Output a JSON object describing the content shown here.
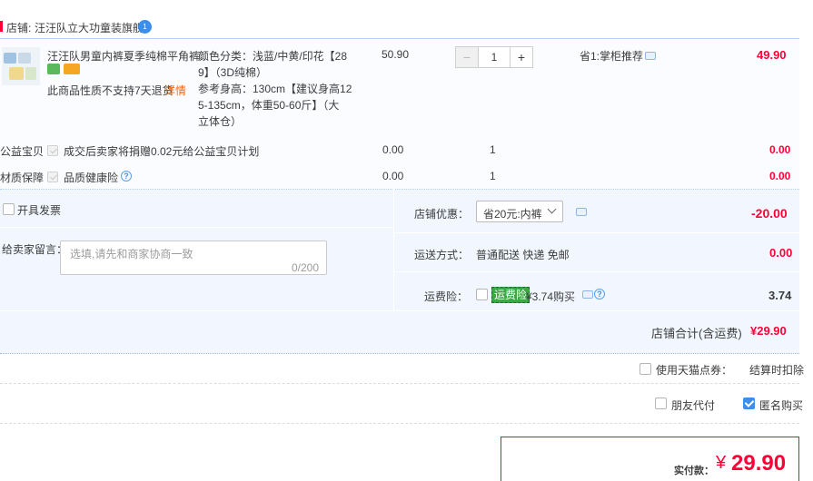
{
  "shop": {
    "label": "店铺:",
    "name": "汪汪队立大功童装旗舰",
    "badge": "1"
  },
  "item": {
    "title": "汪汪队男童内裤夏季纯棉平角裤...",
    "notice": "此商品性质不支持7天退货",
    "detail_link": "详情",
    "sku_lines": [
      "颜色分类：浅蓝/中黄/印花【28",
      "9】（3D纯棉）",
      "参考身高：130cm【建议身高12",
      "5-135cm，体重50-60斤】（大",
      "立体仓）"
    ],
    "price": "50.90",
    "quantity": "1",
    "minus": "−",
    "plus": "+",
    "promo": "省1:掌柜推荐",
    "subtotal": "49.90"
  },
  "services": [
    {
      "category": "公益宝贝",
      "desc": "成交后卖家将捐赠0.02元给公益宝贝计划",
      "price": "0.00",
      "qty": "1",
      "total": "0.00"
    },
    {
      "category": "材质保障",
      "desc": "品质健康险",
      "price": "0.00",
      "qty": "1",
      "total": "0.00"
    }
  ],
  "invoice": {
    "label": "开具发票"
  },
  "message": {
    "label": "给卖家留言：",
    "placeholder": "选填,请先和商家协商一致",
    "counter": "0/200"
  },
  "discount": {
    "label": "店铺优惠：",
    "selected": "省20元:内裤",
    "amount": "-20.00"
  },
  "shipping": {
    "label": "运送方式：",
    "text": "普通配送 快递 免邮",
    "amount": "0.00"
  },
  "freight_insurance": {
    "label": "运费险：",
    "badge": "运费险",
    "price_text": "¥3.74购买",
    "amount": "3.74"
  },
  "shop_total": {
    "label": "店铺合计(含运费)",
    "amount": "¥29.90"
  },
  "coupon": {
    "label": "使用天猫点券：",
    "status": "结算时扣除"
  },
  "options": {
    "friend_pay": "朋友代付",
    "anonymous": "匿名购买"
  },
  "payment": {
    "label": "实付款：",
    "currency": "¥",
    "amount": "29.90"
  },
  "colors": {
    "accent_red": "#ff0036",
    "accent_blue": "#3d8eea",
    "panel_bg": "#f2f7ff"
  }
}
